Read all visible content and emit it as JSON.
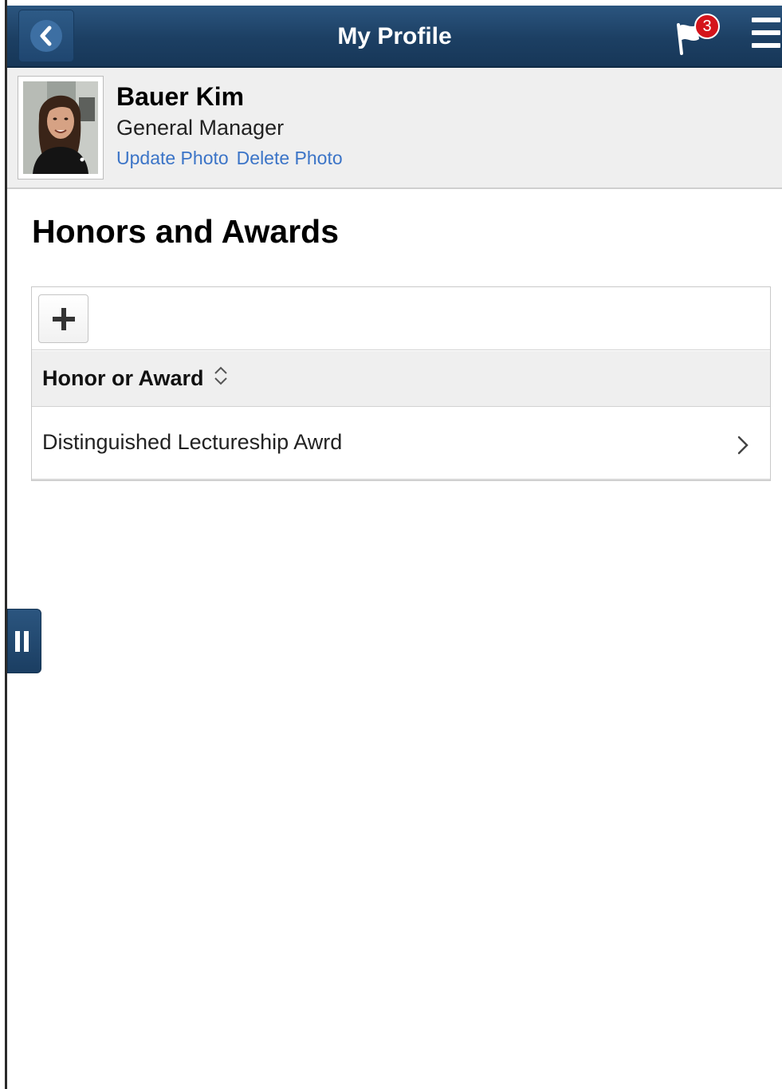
{
  "header": {
    "title": "My Profile",
    "back_icon": "chevron-left-icon",
    "notifications": {
      "icon": "flag-icon",
      "count": "3"
    },
    "menu_icon": "hamburger-icon"
  },
  "profile": {
    "name": "Bauer Kim",
    "job_title": "General Manager",
    "update_photo_label": "Update Photo",
    "delete_photo_label": "Delete Photo"
  },
  "page": {
    "title": "Honors and Awards"
  },
  "grid": {
    "add_icon": "plus-icon",
    "column_header": "Honor or Award",
    "rows": [
      {
        "label": "Distinguished Lectureship Awrd"
      }
    ]
  },
  "colors": {
    "header_bg": "#1c3f63",
    "link": "#3b74c7",
    "badge": "#d4141b",
    "band_bg": "#efefef"
  }
}
